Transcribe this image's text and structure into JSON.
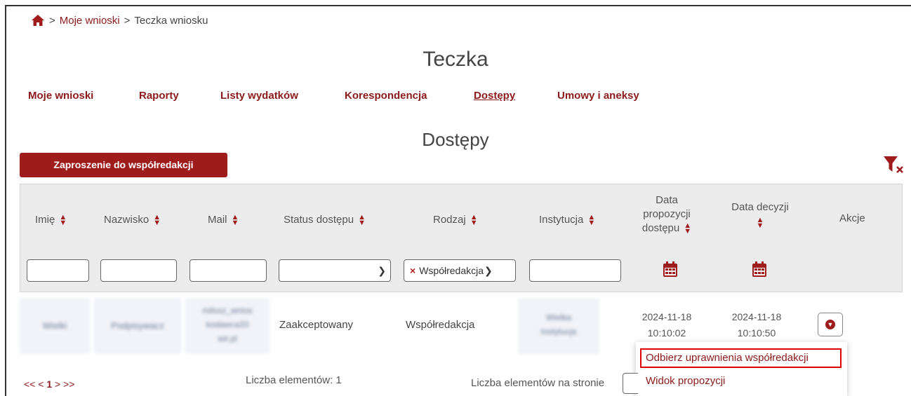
{
  "breadcrumb": {
    "sep": ">",
    "link": "Moje wnioski",
    "current": "Teczka wniosku"
  },
  "page_title": "Teczka",
  "tabs": [
    {
      "label": "Moje wnioski"
    },
    {
      "label": "Raporty"
    },
    {
      "label": "Listy wydatków"
    },
    {
      "label": "Korespondencja"
    },
    {
      "label": "Dostępy",
      "active": true
    },
    {
      "label": "Umowy i aneksy"
    }
  ],
  "section_title": "Dostępy",
  "invite_button": "Zaproszenie do współredakcji",
  "columns": {
    "imie": "Imię",
    "nazwisko": "Nazwisko",
    "mail": "Mail",
    "status": "Status dostępu",
    "rodzaj": "Rodzaj",
    "instytucja": "Instytucja",
    "data_propozycji_1": "Data",
    "data_propozycji_2": "propozycji",
    "data_propozycji_3": "dostępu",
    "data_decyzji": "Data decyzji",
    "akcje": "Akcje"
  },
  "filters": {
    "rodzaj_value": "Współredakcja",
    "rodzaj_remove": "×"
  },
  "row": {
    "imie": "Wielki",
    "nazwisko": "Podpisywacz",
    "mail_1": "milosz_wnios",
    "mail_2": "kodawca33",
    "mail_3": "wir.pl",
    "status": "Zaakceptowany",
    "rodzaj": "Współredakcja",
    "instytucja_1": "Wielka",
    "instytucja_2": "Instytucja",
    "data_propozycji_date": "2024-11-18",
    "data_propozycji_time": "10:10:02",
    "data_decyzji_date": "2024-11-18",
    "data_decyzji_time": "10:10:50"
  },
  "dropdown": {
    "item1": "Odbierz uprawnienia współredakcji",
    "item2": "Widok propozycji"
  },
  "pager": {
    "first": "<<",
    "prev": "<",
    "current": "1",
    "next": ">",
    "last": ">>"
  },
  "count_label": "Liczba elementów: 1",
  "per_page_label": "Liczba elementów na stronie",
  "colors": {
    "accent": "#9f1c1c",
    "link": "#8b1a1a",
    "highlight": "#e00000"
  },
  "icons": [
    "home-icon",
    "sort-icon",
    "calendar-icon",
    "filter-clear-icon",
    "chevron-down-icon",
    "chevron-circle-icon"
  ]
}
